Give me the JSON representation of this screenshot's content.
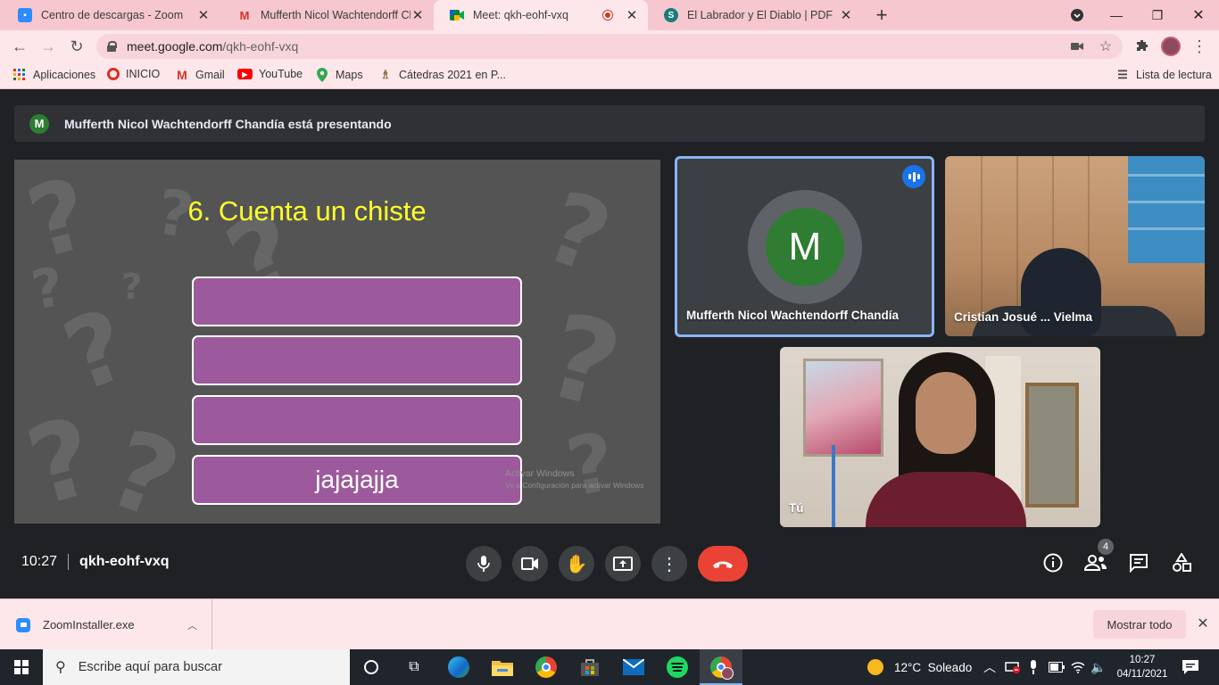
{
  "browser": {
    "tabs": [
      {
        "title": "Centro de descargas - Zoom",
        "favicon": "zoom-icon"
      },
      {
        "title": "Mufferth Nicol Wachtendorff Cha",
        "favicon": "gmail-icon"
      },
      {
        "title": "Meet: qkh-eohf-vxq",
        "favicon": "meet-icon",
        "recording": true
      },
      {
        "title": "El Labrador y El Diablo | PDF",
        "favicon": "scribd-icon"
      }
    ],
    "url_host": "meet.google.com",
    "url_path": "/qkh-eohf-vxq",
    "bookmarks": [
      "Aplicaciones",
      "INICIO",
      "Gmail",
      "YouTube",
      "Maps",
      "Cátedras 2021 en P..."
    ],
    "reading_list": "Lista de lectura"
  },
  "meet": {
    "presenter_initial": "M",
    "presenter_text": "Mufferth Nicol Wachtendorff Chandía está presentando",
    "slide": {
      "title": "6. Cuenta un chiste",
      "answers": [
        "",
        "",
        "",
        "jajajajja"
      ],
      "watermark_line1": "Activar Windows",
      "watermark_line2": "Ve a Configuración para activar Windows"
    },
    "participants": [
      {
        "name": "Mufferth Nicol Wachtendorff Chandía",
        "initial": "M",
        "avatar_color": "#2e7d32",
        "speaking": true
      },
      {
        "name": "Cristian Josué ... Vielma"
      },
      {
        "name": "Tú"
      }
    ],
    "time": "10:27",
    "meeting_code": "qkh-eohf-vxq",
    "participant_count": "4",
    "accent_end_call": "#ea4335"
  },
  "downloads": {
    "file": "ZoomInstaller.exe",
    "show_all": "Mostrar todo"
  },
  "taskbar": {
    "search_placeholder": "Escribe aquí para buscar",
    "weather": "12°C  Soleado",
    "time": "10:27",
    "date": "04/11/2021"
  }
}
